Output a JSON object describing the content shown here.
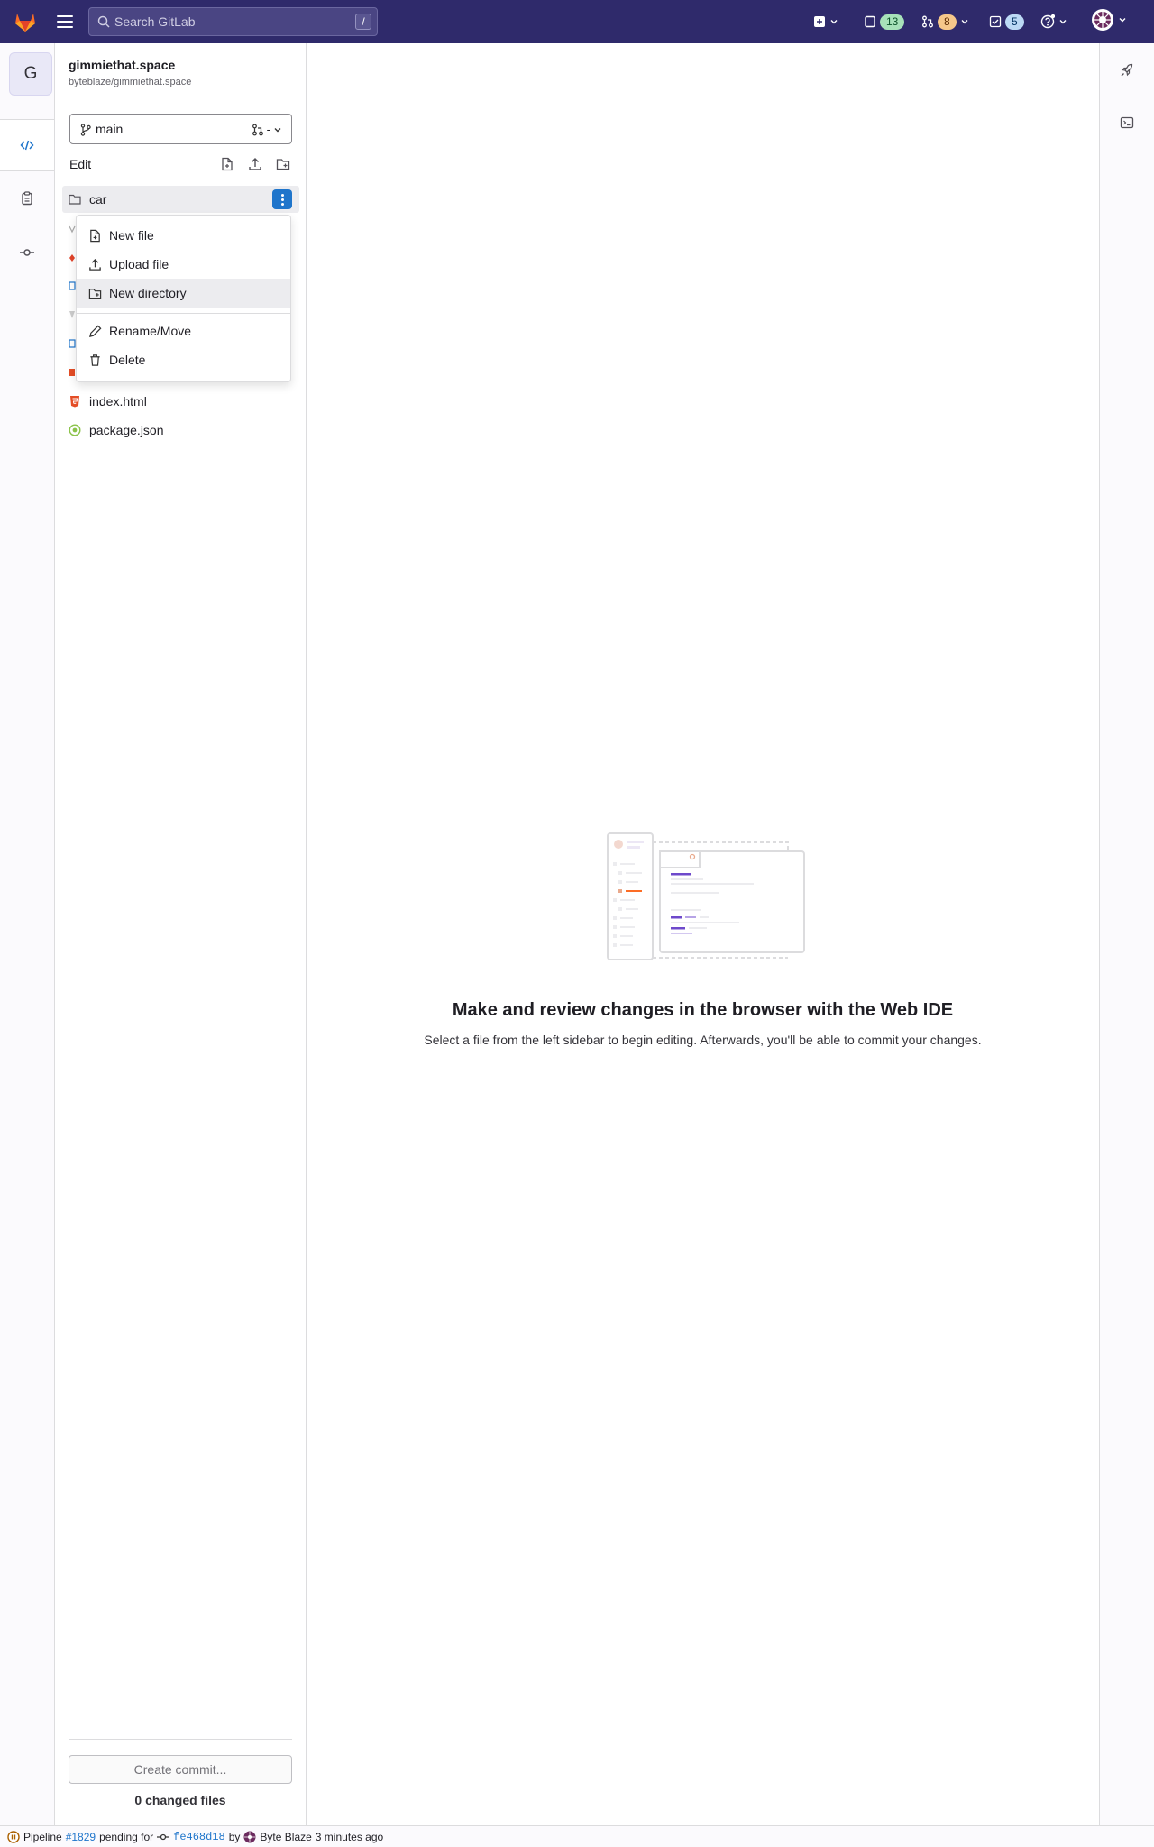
{
  "topbar": {
    "search_placeholder": "Search GitLab",
    "search_shortcut": "/",
    "issues_count": "13",
    "merge_requests_count": "8",
    "todos_count": "5",
    "colors": {
      "bg": "#2f2a6b",
      "issues_badge": "#a7e1b9",
      "mr_badge": "#f6c78a",
      "todo_badge": "#bcd9f5"
    }
  },
  "project": {
    "avatar_letter": "G",
    "name": "gimmiethat.space",
    "path": "byteblaze/gimmiethat.space"
  },
  "branch": {
    "name": "main",
    "mr_label": "-"
  },
  "tree": {
    "edit_label": "Edit",
    "selected_folder": "car",
    "files": [
      "index.html",
      "package.json"
    ]
  },
  "context_menu": {
    "items": [
      "New file",
      "Upload file",
      "New directory",
      "Rename/Move",
      "Delete"
    ]
  },
  "commit": {
    "button_label": "Create commit...",
    "changed_files": "0 changed files"
  },
  "main": {
    "title": "Make and review changes in the browser with the Web IDE",
    "subtitle": "Select a file from the left sidebar to begin editing. Afterwards, you'll be able to commit your changes."
  },
  "status": {
    "prefix": "Pipeline",
    "pipeline_id": "#1829",
    "middle": "pending for",
    "commit_sha": "fe468d18",
    "by": "by",
    "author": "Byte Blaze",
    "time": "3 minutes ago"
  }
}
